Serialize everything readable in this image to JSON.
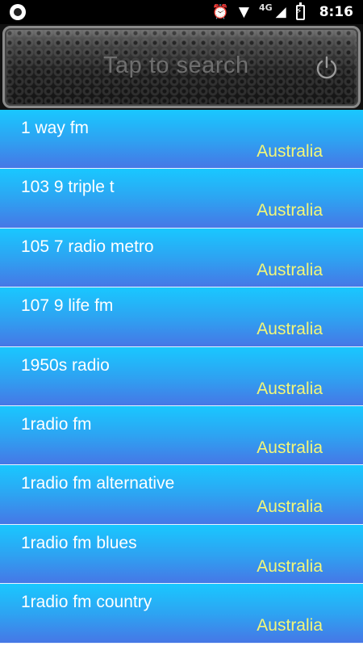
{
  "status_bar": {
    "network": "4G",
    "time": "8:16"
  },
  "header": {
    "search_placeholder": "Tap to search",
    "power_icon": "power-icon"
  },
  "colors": {
    "item_top": "#19c8ff",
    "item_bottom": "#4677e6",
    "station_name": "#ffffff",
    "country": "#f3f778"
  },
  "stations": [
    {
      "name": "1 way fm",
      "country": "Australia"
    },
    {
      "name": "103 9 triple t",
      "country": "Australia"
    },
    {
      "name": "105 7 radio metro",
      "country": "Australia"
    },
    {
      "name": "107 9 life fm",
      "country": "Australia"
    },
    {
      "name": "1950s radio",
      "country": "Australia"
    },
    {
      "name": "1radio fm",
      "country": "Australia"
    },
    {
      "name": "1radio fm alternative",
      "country": "Australia"
    },
    {
      "name": "1radio fm blues",
      "country": "Australia"
    },
    {
      "name": "1radio fm country",
      "country": "Australia"
    }
  ]
}
